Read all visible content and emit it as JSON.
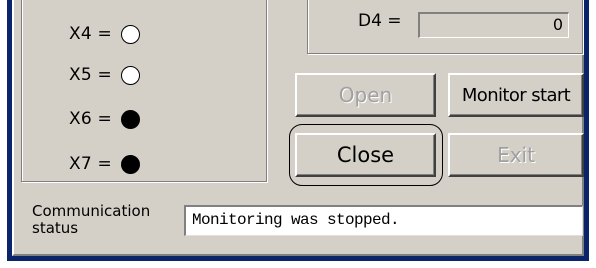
{
  "inputs": [
    {
      "label": "X4 =",
      "state": "off"
    },
    {
      "label": "X5 =",
      "state": "off"
    },
    {
      "label": "X6 =",
      "state": "on"
    },
    {
      "label": "X7 =",
      "state": "on"
    }
  ],
  "data_register": {
    "label": "D4 =",
    "value": "0"
  },
  "buttons": {
    "open_label": "Open",
    "monitor_start_label": "Monitor start",
    "close_label": "Close",
    "exit_label": "Exit"
  },
  "communication": {
    "label_line1": "Communication",
    "label_line2": "status",
    "status_text": "Monitoring was stopped."
  },
  "colors": {
    "window_face": "#d4d0c8",
    "title_blue": "#0a246a",
    "lamp_on": "#000000",
    "lamp_off": "#ffffff"
  }
}
